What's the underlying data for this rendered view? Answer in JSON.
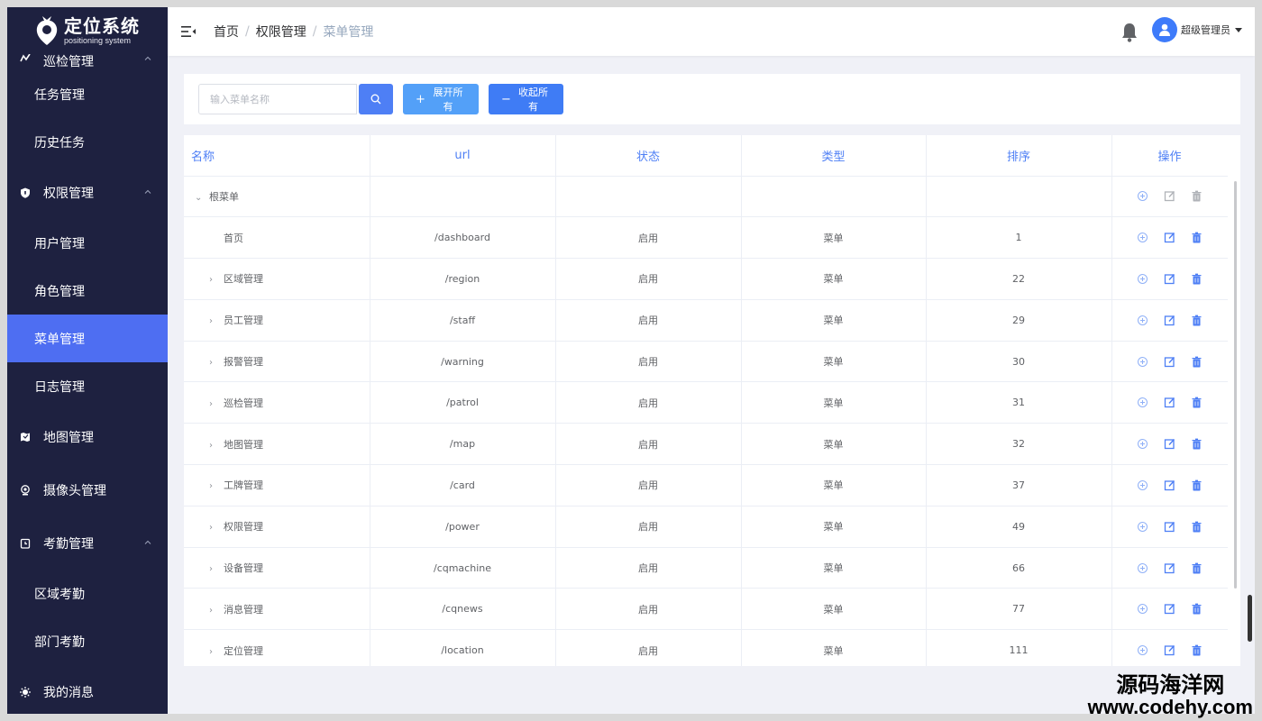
{
  "logo": {
    "title": "定位系统",
    "subtitle": "positioning system"
  },
  "sidebar": {
    "items": [
      {
        "label": "巡检管理",
        "level": "top",
        "icon": "patrol-icon",
        "caret": "up",
        "cut": true
      },
      {
        "label": "任务管理",
        "level": "sub"
      },
      {
        "label": "历史任务",
        "level": "sub"
      },
      {
        "label": "权限管理",
        "level": "top",
        "icon": "shield-icon",
        "caret": "up"
      },
      {
        "label": "用户管理",
        "level": "sub"
      },
      {
        "label": "角色管理",
        "level": "sub"
      },
      {
        "label": "菜单管理",
        "level": "sub",
        "active": true
      },
      {
        "label": "日志管理",
        "level": "sub"
      },
      {
        "label": "地图管理",
        "level": "top",
        "icon": "map-icon"
      },
      {
        "label": "摄像头管理",
        "level": "top",
        "icon": "camera-icon"
      },
      {
        "label": "考勤管理",
        "level": "top",
        "icon": "clock-icon",
        "caret": "up"
      },
      {
        "label": "区域考勤",
        "level": "sub"
      },
      {
        "label": "部门考勤",
        "level": "sub"
      },
      {
        "label": "我的消息",
        "level": "top",
        "icon": "message-icon"
      }
    ]
  },
  "header": {
    "breadcrumb": [
      "首页",
      "权限管理",
      "菜单管理"
    ],
    "user_name": "超级管理员"
  },
  "toolbar": {
    "search_placeholder": "输入菜单名称",
    "search_value": "",
    "expand_label": "展开所有",
    "collapse_label": "收起所有"
  },
  "table": {
    "headers": [
      "名称",
      "url",
      "状态",
      "类型",
      "排序",
      "操作"
    ],
    "rows": [
      {
        "name": "根菜单",
        "url": "",
        "status": "",
        "type": "",
        "sort": "",
        "arrow": "down",
        "indent": 0,
        "root": true
      },
      {
        "name": "首页",
        "url": "/dashboard",
        "status": "启用",
        "type": "菜单",
        "sort": "1",
        "arrow": "",
        "indent": 1
      },
      {
        "name": "区域管理",
        "url": "/region",
        "status": "启用",
        "type": "菜单",
        "sort": "22",
        "arrow": "right",
        "indent": 1
      },
      {
        "name": "员工管理",
        "url": "/staff",
        "status": "启用",
        "type": "菜单",
        "sort": "29",
        "arrow": "right",
        "indent": 1
      },
      {
        "name": "报警管理",
        "url": "/warning",
        "status": "启用",
        "type": "菜单",
        "sort": "30",
        "arrow": "right",
        "indent": 1
      },
      {
        "name": "巡检管理",
        "url": "/patrol",
        "status": "启用",
        "type": "菜单",
        "sort": "31",
        "arrow": "right",
        "indent": 1
      },
      {
        "name": "地图管理",
        "url": "/map",
        "status": "启用",
        "type": "菜单",
        "sort": "32",
        "arrow": "right",
        "indent": 1
      },
      {
        "name": "工牌管理",
        "url": "/card",
        "status": "启用",
        "type": "菜单",
        "sort": "37",
        "arrow": "right",
        "indent": 1
      },
      {
        "name": "权限管理",
        "url": "/power",
        "status": "启用",
        "type": "菜单",
        "sort": "49",
        "arrow": "right",
        "indent": 1
      },
      {
        "name": "设备管理",
        "url": "/cqmachine",
        "status": "启用",
        "type": "菜单",
        "sort": "66",
        "arrow": "right",
        "indent": 1
      },
      {
        "name": "消息管理",
        "url": "/cqnews",
        "status": "启用",
        "type": "菜单",
        "sort": "77",
        "arrow": "right",
        "indent": 1
      },
      {
        "name": "定位管理",
        "url": "/location",
        "status": "启用",
        "type": "菜单",
        "sort": "111",
        "arrow": "right",
        "indent": 1
      }
    ]
  },
  "watermark": {
    "line1": "源码海洋网",
    "line2": "www.codehy.com"
  },
  "colors": {
    "sidebar_bg": "#1e2140",
    "accent": "#4e6ef2",
    "header_text": "#4e7ff5"
  }
}
